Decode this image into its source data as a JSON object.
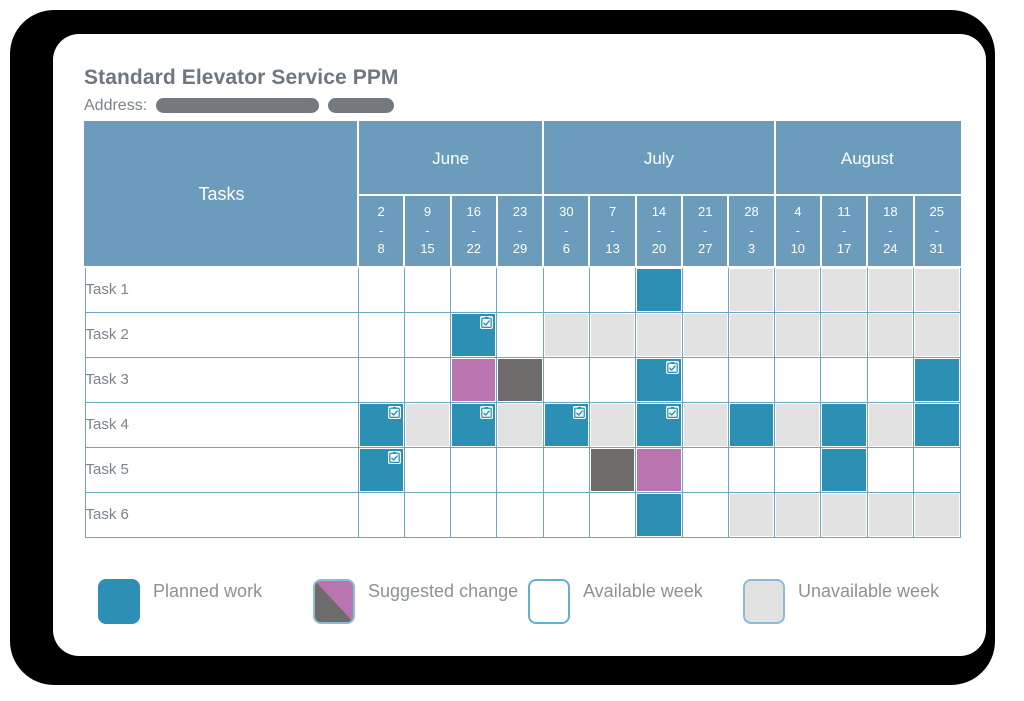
{
  "header": {
    "title": "Standard Elevator Service PPM",
    "address_label": "Address:",
    "address_redacted": [
      "",
      ""
    ]
  },
  "table": {
    "tasks_header": "Tasks",
    "months": [
      {
        "name": "June",
        "span": 4
      },
      {
        "name": "July",
        "span": 5
      },
      {
        "name": "August",
        "span": 4
      }
    ],
    "weeks": [
      {
        "start": "2",
        "dash": "-",
        "end": "8"
      },
      {
        "start": "9",
        "dash": "-",
        "end": "15"
      },
      {
        "start": "16",
        "dash": "-",
        "end": "22"
      },
      {
        "start": "23",
        "dash": "-",
        "end": "29"
      },
      {
        "start": "30",
        "dash": "-",
        "end": "6"
      },
      {
        "start": "7",
        "dash": "-",
        "end": "13"
      },
      {
        "start": "14",
        "dash": "-",
        "end": "20"
      },
      {
        "start": "21",
        "dash": "-",
        "end": "27"
      },
      {
        "start": "28",
        "dash": "-",
        "end": "3"
      },
      {
        "start": "4",
        "dash": "-",
        "end": "10"
      },
      {
        "start": "11",
        "dash": "-",
        "end": "17"
      },
      {
        "start": "18",
        "dash": "-",
        "end": "24"
      },
      {
        "start": "25",
        "dash": "-",
        "end": "31"
      }
    ],
    "rows": [
      {
        "task": "Task 1",
        "cells": [
          {
            "state": "available"
          },
          {
            "state": "available"
          },
          {
            "state": "available"
          },
          {
            "state": "available"
          },
          {
            "state": "available"
          },
          {
            "state": "available"
          },
          {
            "state": "planned"
          },
          {
            "state": "available"
          },
          {
            "state": "unavailable"
          },
          {
            "state": "unavailable"
          },
          {
            "state": "unavailable"
          },
          {
            "state": "unavailable"
          },
          {
            "state": "unavailable"
          }
        ]
      },
      {
        "task": "Task 2",
        "cells": [
          {
            "state": "available"
          },
          {
            "state": "available"
          },
          {
            "state": "planned",
            "badge": true
          },
          {
            "state": "available"
          },
          {
            "state": "unavailable"
          },
          {
            "state": "unavailable"
          },
          {
            "state": "unavailable"
          },
          {
            "state": "unavailable"
          },
          {
            "state": "unavailable"
          },
          {
            "state": "unavailable"
          },
          {
            "state": "unavailable"
          },
          {
            "state": "unavailable"
          },
          {
            "state": "unavailable"
          }
        ]
      },
      {
        "task": "Task 3",
        "cells": [
          {
            "state": "available"
          },
          {
            "state": "available"
          },
          {
            "state": "suggested-new"
          },
          {
            "state": "suggested-old"
          },
          {
            "state": "available"
          },
          {
            "state": "available"
          },
          {
            "state": "planned",
            "badge": true
          },
          {
            "state": "available"
          },
          {
            "state": "available"
          },
          {
            "state": "available"
          },
          {
            "state": "available"
          },
          {
            "state": "available"
          },
          {
            "state": "planned"
          }
        ]
      },
      {
        "task": "Task 4",
        "cells": [
          {
            "state": "planned",
            "badge": true
          },
          {
            "state": "unavailable"
          },
          {
            "state": "planned",
            "badge": true
          },
          {
            "state": "unavailable"
          },
          {
            "state": "planned",
            "badge": true
          },
          {
            "state": "unavailable"
          },
          {
            "state": "planned",
            "badge": true
          },
          {
            "state": "unavailable"
          },
          {
            "state": "planned"
          },
          {
            "state": "unavailable"
          },
          {
            "state": "planned"
          },
          {
            "state": "unavailable"
          },
          {
            "state": "planned"
          }
        ]
      },
      {
        "task": "Task 5",
        "cells": [
          {
            "state": "planned",
            "badge": true
          },
          {
            "state": "available"
          },
          {
            "state": "available"
          },
          {
            "state": "available"
          },
          {
            "state": "available"
          },
          {
            "state": "suggested-old"
          },
          {
            "state": "suggested-new"
          },
          {
            "state": "available"
          },
          {
            "state": "available"
          },
          {
            "state": "available"
          },
          {
            "state": "planned"
          },
          {
            "state": "available"
          },
          {
            "state": "available"
          }
        ]
      },
      {
        "task": "Task 6",
        "cells": [
          {
            "state": "available"
          },
          {
            "state": "available"
          },
          {
            "state": "available"
          },
          {
            "state": "available"
          },
          {
            "state": "available"
          },
          {
            "state": "available"
          },
          {
            "state": "planned"
          },
          {
            "state": "available"
          },
          {
            "state": "unavailable"
          },
          {
            "state": "unavailable"
          },
          {
            "state": "unavailable"
          },
          {
            "state": "unavailable"
          },
          {
            "state": "unavailable"
          }
        ]
      }
    ]
  },
  "legend": [
    {
      "key": "planned",
      "label": "Planned work"
    },
    {
      "key": "suggested",
      "label": "Suggested change"
    },
    {
      "key": "available",
      "label": "Available week"
    },
    {
      "key": "unavailable",
      "label": "Unavailable week"
    }
  ],
  "colors": {
    "header_blue": "#6b9cbb",
    "grid_border": "#6aa7c4",
    "planned": "#2b90b4",
    "suggested_new": "#b875b0",
    "suggested_old": "#6e6c6a",
    "unavailable": "#e2e2e2",
    "available": "#ffffff",
    "text_gray": "#7b838c",
    "title_gray": "#6e7680"
  }
}
